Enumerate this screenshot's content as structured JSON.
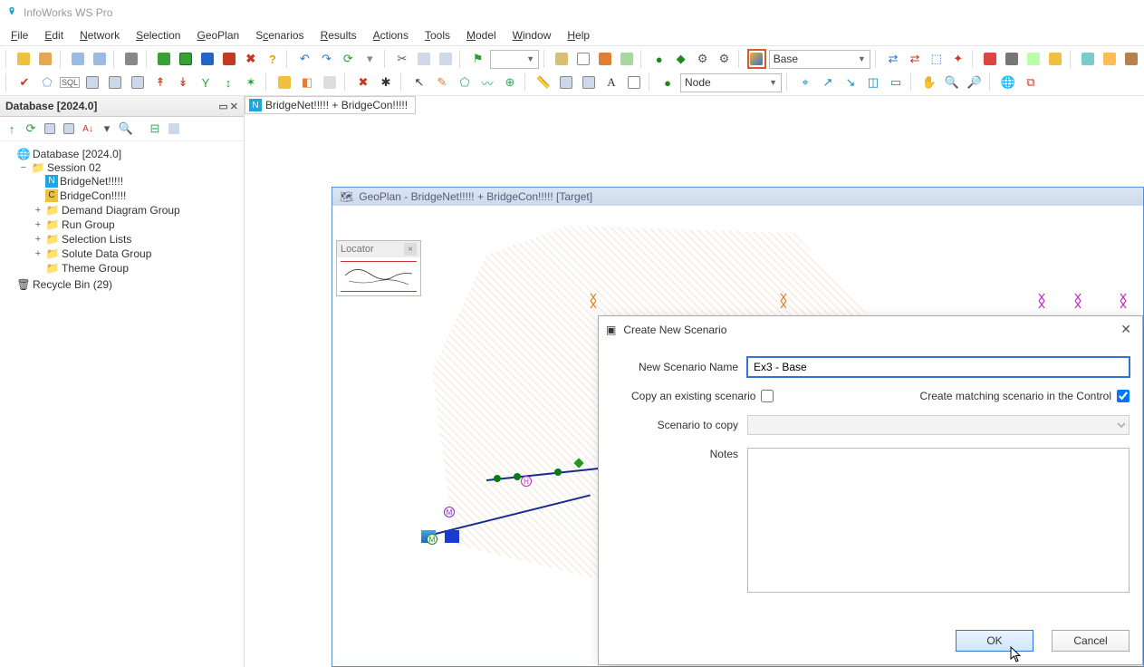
{
  "app": {
    "title": "InfoWorks WS Pro"
  },
  "menus": [
    "File",
    "Edit",
    "Network",
    "Selection",
    "GeoPlan",
    "Scenarios",
    "Results",
    "Actions",
    "Tools",
    "Model",
    "Window",
    "Help"
  ],
  "toolbar": {
    "scenario_dropdown": "Base",
    "object_dropdown": "Node",
    "blank_dropdown": ""
  },
  "database_panel": {
    "title": "Database [2024.0]",
    "tree": {
      "root": "Database [2024.0]",
      "session": "Session 02",
      "items": [
        "BridgeNet!!!!!",
        "BridgeCon!!!!!",
        "Demand Diagram Group",
        "Run Group",
        "Selection Lists",
        "Solute Data Group",
        "Theme Group"
      ],
      "recycle": "Recycle Bin (29)"
    }
  },
  "document_tab": "BridgeNet!!!!! + BridgeCon!!!!!",
  "geoplan": {
    "title": "GeoPlan - BridgeNet!!!!! + BridgeCon!!!!! [Target]",
    "locator_title": "Locator"
  },
  "dialog": {
    "title": "Create New Scenario",
    "labels": {
      "name": "New Scenario Name",
      "copy_existing": "Copy an existing scenario",
      "create_matching": "Create matching scenario in the Control",
      "scenario_to_copy": "Scenario to copy",
      "notes": "Notes"
    },
    "values": {
      "name": "Ex3 - Base",
      "copy_existing_checked": false,
      "create_matching_checked": true,
      "scenario_to_copy": "",
      "notes": ""
    },
    "buttons": {
      "ok": "OK",
      "cancel": "Cancel"
    }
  }
}
